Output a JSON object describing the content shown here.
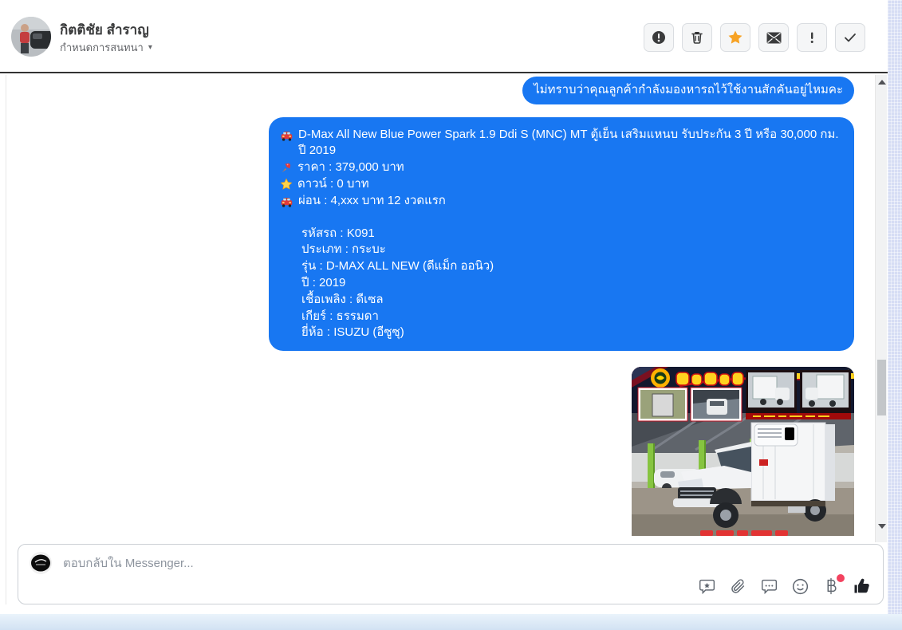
{
  "colors": {
    "bubble_blue": "#1877f2",
    "star_active": "#f7a325",
    "notification_dot": "#f3425f",
    "right_strip": "#d6ddf4",
    "bottom_strip": "#d9e7f6"
  },
  "header": {
    "contact_name": "กิตติชัย สำราญ",
    "conversation_label": "กำหนดการสนทนา",
    "caret": "▾",
    "toolbar_icons": [
      "report-icon",
      "delete-icon",
      "star-icon",
      "mark-unread-icon",
      "mark-spam-icon",
      "mark-done-icon"
    ],
    "star_icon_state": "active"
  },
  "chat": {
    "messages": [
      {
        "type": "text",
        "direction": "outgoing",
        "text": "ไม่ทราบว่าคุณลูกค้ากำลังมองหารถไว้ใช้งานสักคันอยู่ไหมคะ"
      },
      {
        "type": "multiline",
        "direction": "outgoing",
        "lines": [
          {
            "icon": "car-emoji",
            "text": "D-Max All New Blue Power Spark 1.9 Ddi S (MNC) MT ตู้เย็น เสริมแหนบ รับประกัน 3 ปี หรือ 30,000 กม. ปี 2019"
          },
          {
            "icon": "pushpin-emoji",
            "text": "ราคา : 379,000 บาท"
          },
          {
            "icon": "star-emoji",
            "text": "ดาวน์ : 0 บาท"
          },
          {
            "icon": "car-emoji",
            "text": "ผ่อน : 4,xxx บาท 12 งวดแรก"
          },
          {
            "icon": "",
            "text": ""
          },
          {
            "icon": "",
            "text": "รหัสรถ : K091"
          },
          {
            "icon": "",
            "text": "ประเภท : กระบะ"
          },
          {
            "icon": "",
            "text": "รุ่น : D-MAX ALL NEW (ดีแม็ก ออนิว)"
          },
          {
            "icon": "",
            "text": "ปี : 2019"
          },
          {
            "icon": "",
            "text": "เชื้อเพลิง : ดีเซล"
          },
          {
            "icon": "",
            "text": "เกียร์ : ธรรมดา"
          },
          {
            "icon": "",
            "text": "ยี่ห้อ : ISUZU (อีซูซุ)"
          }
        ]
      },
      {
        "type": "image",
        "direction": "outgoing",
        "name": "photo-attachment-refrigerated-truck"
      }
    ]
  },
  "composer": {
    "placeholder": "ตอบกลับใน Messenger...",
    "icons": [
      "sticker-icon",
      "attachment-icon",
      "saved-replies-icon",
      "emoji-icon",
      "payment-icon",
      "like-icon"
    ]
  }
}
